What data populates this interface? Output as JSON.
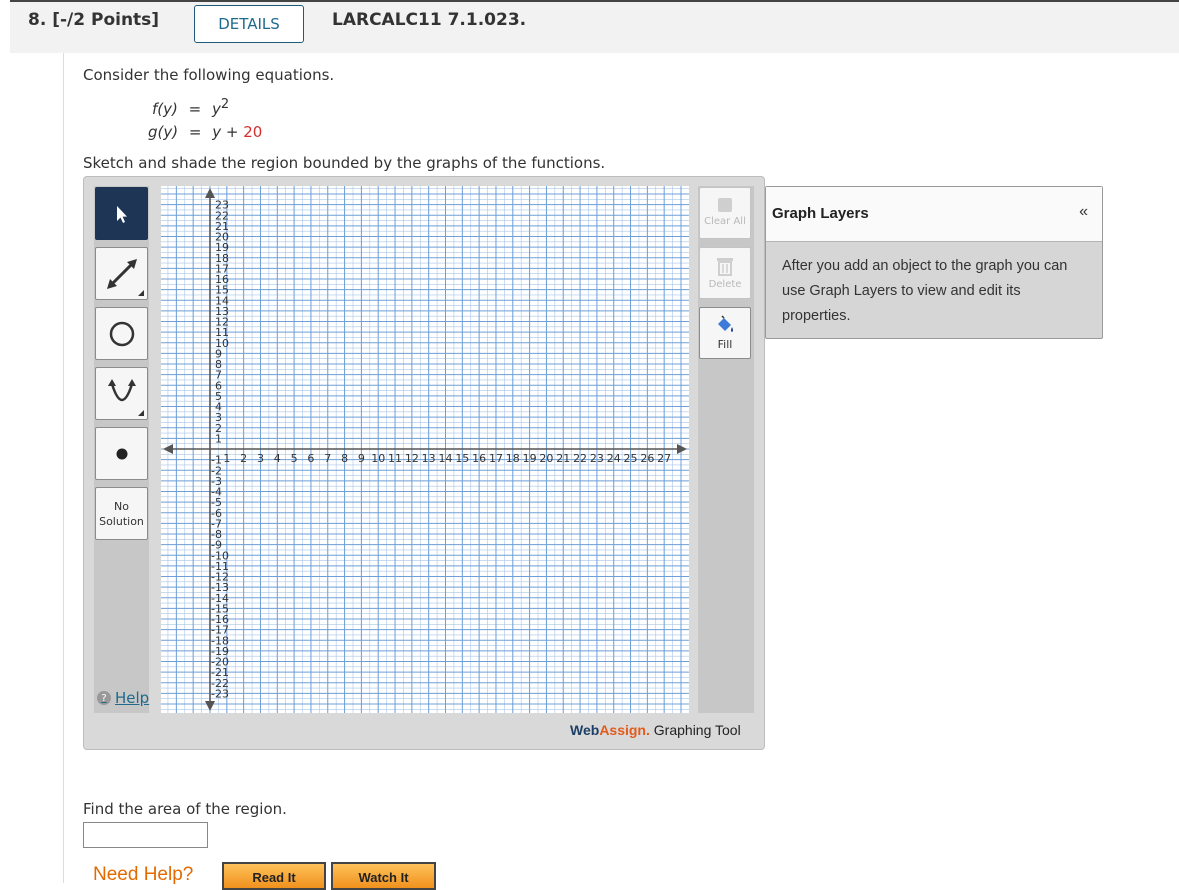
{
  "header": {
    "question_number": "8. [-/2 Points]",
    "details_label": "DETAILS",
    "question_id": "LARCALC11 7.1.023."
  },
  "problem": {
    "intro": "Consider the following equations.",
    "f_name": "f(y)",
    "f_equals": "=",
    "f_base": "y",
    "f_exp": "2",
    "g_name": "g(y)",
    "g_equals": "=",
    "g_expr": "y +",
    "g_const": "20",
    "instruction": "Sketch and shade the region bounded by the graphs of the functions.",
    "area_prompt": "Find the area of the region."
  },
  "graph_tool": {
    "tools": [
      {
        "name": "pointer-tool",
        "icon": "pointer-arrow-icon"
      },
      {
        "name": "line-tool",
        "icon": "line-icon"
      },
      {
        "name": "circle-tool",
        "icon": "circle-icon"
      },
      {
        "name": "parabola-tool",
        "icon": "parabola-icon"
      },
      {
        "name": "point-tool",
        "icon": "point-icon"
      }
    ],
    "no_solution_line1": "No",
    "no_solution_line2": "Solution",
    "help_label": "Help",
    "clear_all_label": "Clear All",
    "delete_label": "Delete",
    "fill_label": "Fill",
    "brand_web": "Web",
    "brand_assign": "Assign.",
    "brand_suffix": " Graphing Tool",
    "accent_color": "#1e3555"
  },
  "graph_layers": {
    "title": "Graph Layers",
    "collapse_symbol": "«",
    "description": "After you add an object to the graph you can use Graph Layers to view and edit its properties."
  },
  "axes": {
    "x_ticks": [
      "1",
      "2",
      "3",
      "4",
      "5",
      "6",
      "7",
      "8",
      "9",
      "10",
      "11",
      "12",
      "13",
      "14",
      "15",
      "16",
      "17",
      "18",
      "19",
      "20",
      "21",
      "22",
      "23",
      "24",
      "25",
      "26",
      "27"
    ],
    "y_pos_ticks": [
      "1",
      "2",
      "3",
      "4",
      "5",
      "6",
      "7",
      "8",
      "9",
      "10",
      "11",
      "12",
      "13",
      "14",
      "15",
      "16",
      "17",
      "18",
      "19",
      "20",
      "21",
      "22",
      "23"
    ],
    "y_neg_ticks": [
      "-1",
      "-2",
      "-3",
      "-4",
      "-5",
      "-6",
      "-7",
      "-8",
      "-9",
      "-10",
      "-11",
      "-12",
      "-13",
      "-14",
      "-15",
      "-16",
      "-17",
      "-18",
      "-19",
      "-20",
      "-21",
      "-22",
      "-23"
    ]
  },
  "answer": {
    "value": ""
  },
  "help_row": {
    "need_help": "Need Help?",
    "read_it": "Read It",
    "watch_it": "Watch It"
  }
}
